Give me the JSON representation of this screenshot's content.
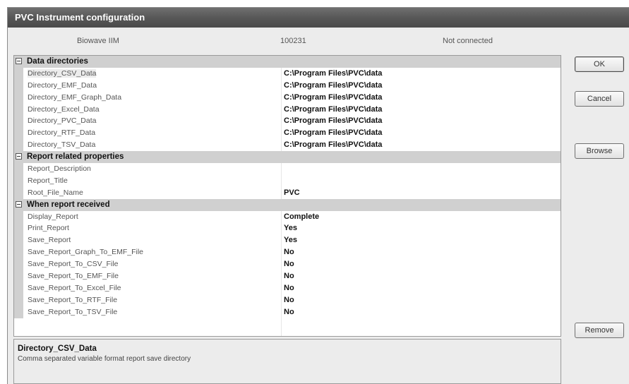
{
  "window": {
    "title": "PVC Instrument configuration"
  },
  "info": {
    "device": "Biowave IIM",
    "serial": "100231",
    "status": "Not connected"
  },
  "categories": [
    {
      "label": "Data directories",
      "properties": [
        {
          "name": "Directory_CSV_Data",
          "value": "C:\\Program Files\\PVC\\data"
        },
        {
          "name": "Directory_EMF_Data",
          "value": "C:\\Program Files\\PVC\\data"
        },
        {
          "name": "Directory_EMF_Graph_Data",
          "value": "C:\\Program Files\\PVC\\data"
        },
        {
          "name": "Directory_Excel_Data",
          "value": "C:\\Program Files\\PVC\\data"
        },
        {
          "name": "Directory_PVC_Data",
          "value": "C:\\Program Files\\PVC\\data"
        },
        {
          "name": "Directory_RTF_Data",
          "value": "C:\\Program Files\\PVC\\data"
        },
        {
          "name": "Directory_TSV_Data",
          "value": "C:\\Program Files\\PVC\\data"
        }
      ]
    },
    {
      "label": "Report related properties",
      "properties": [
        {
          "name": "Report_Description",
          "value": ""
        },
        {
          "name": "Report_Title",
          "value": ""
        },
        {
          "name": "Root_File_Name",
          "value": "PVC"
        }
      ]
    },
    {
      "label": "When report received",
      "properties": [
        {
          "name": "Display_Report",
          "value": "Complete"
        },
        {
          "name": "Print_Report",
          "value": "Yes"
        },
        {
          "name": "Save_Report",
          "value": "Yes"
        },
        {
          "name": "Save_Report_Graph_To_EMF_File",
          "value": "No"
        },
        {
          "name": "Save_Report_To_CSV_File",
          "value": "No"
        },
        {
          "name": "Save_Report_To_EMF_File",
          "value": "No"
        },
        {
          "name": "Save_Report_To_Excel_File",
          "value": "No"
        },
        {
          "name": "Save_Report_To_RTF_File",
          "value": "No"
        },
        {
          "name": "Save_Report_To_TSV_File",
          "value": "No"
        }
      ]
    }
  ],
  "description": {
    "title": "Directory_CSV_Data",
    "text": "Comma separated variable format report save directory"
  },
  "buttons": {
    "ok": "OK",
    "cancel": "Cancel",
    "browse": "Browse",
    "remove": "Remove"
  }
}
